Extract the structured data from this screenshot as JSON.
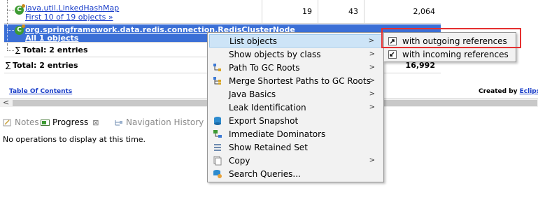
{
  "table": {
    "rows": [
      {
        "class_name": "java.util.LinkedHashMap",
        "sub_link": "First 10 of 19 objects »",
        "objects": "19",
        "shallow": "43",
        "retained": "2,064"
      },
      {
        "class_name": "org.springframework.data.redis.connection.RedisClusterNode",
        "sub_link": "All 1 objects",
        "objects": "",
        "shallow": "",
        "retained": ""
      }
    ],
    "inner_total": "Total: 2 entries",
    "outer_total": "Total: 2 entries",
    "outer_total_retained": "16,992",
    "sigma": "∑"
  },
  "footer": {
    "toc": "Table Of Contents",
    "created_by": "Created by",
    "created_by_link": "Eclips"
  },
  "tabs": [
    {
      "label": "Notes",
      "icon": "notes-icon"
    },
    {
      "label": "Progress",
      "icon": "progress-icon",
      "close": "⊠"
    },
    {
      "label": "Navigation History",
      "icon": "navigation-history-icon"
    }
  ],
  "status_message": "No operations to display at this time.",
  "context_menu": {
    "items": [
      {
        "label": "List objects",
        "icon": "",
        "submenu": true,
        "hover": true
      },
      {
        "label": "Show objects by class",
        "icon": "",
        "submenu": true
      },
      {
        "label": "Path To GC Roots",
        "icon": "path-gc-roots-icon",
        "submenu": true
      },
      {
        "label": "Merge Shortest Paths to GC Roots",
        "icon": "merge-paths-icon",
        "submenu": true
      },
      {
        "label": "Java Basics",
        "icon": "",
        "submenu": true
      },
      {
        "label": "Leak Identification",
        "icon": "",
        "submenu": true
      },
      {
        "label": "Export Snapshot",
        "icon": "export-snapshot-icon",
        "submenu": false
      },
      {
        "label": "Immediate Dominators",
        "icon": "immediate-dominators-icon",
        "submenu": false
      },
      {
        "label": "Show Retained Set",
        "icon": "retained-set-icon",
        "submenu": false
      },
      {
        "label": "Copy",
        "icon": "copy-icon",
        "submenu": true
      },
      {
        "label": "Search Queries...",
        "icon": "search-queries-icon",
        "submenu": false
      }
    ],
    "submenu_arrow": ">"
  },
  "submenu": {
    "items": [
      {
        "label": "with outgoing references",
        "icon": "outgoing-references-icon"
      },
      {
        "label": "with incoming references",
        "icon": "incoming-references-icon"
      }
    ]
  },
  "colors": {
    "selection": "#3b6fd6",
    "link": "#1a3ec9",
    "menu_hover": "#cde4f7",
    "highlight_border": "#e53030"
  }
}
